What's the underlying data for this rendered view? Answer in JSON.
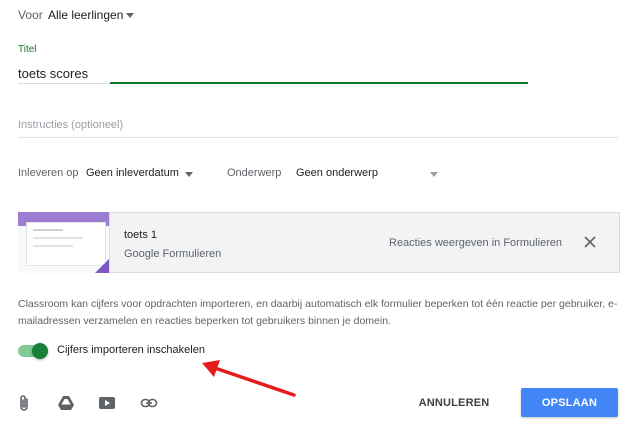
{
  "audience": {
    "label": "Voor",
    "value": "Alle leerlingen"
  },
  "title_field": {
    "label": "Titel",
    "value": "toets scores"
  },
  "instructions_field": {
    "placeholder": "Instructies (optioneel)",
    "value": ""
  },
  "due": {
    "label": "Inleveren op",
    "value": "Geen inleverdatum"
  },
  "topic": {
    "label": "Onderwerp",
    "value": "Geen onderwerp"
  },
  "attachment": {
    "title": "toets 1",
    "type": "Google Formulieren",
    "action": "Reacties weergeven in Formulieren",
    "thumbnail_color": "#9c7dd1"
  },
  "info_text": "Classroom kan cijfers voor opdrachten importeren, en daarbij automatisch elk formulier beperken tot één reactie per gebruiker, e-mailadressen verzamelen en reacties beperken tot gebruikers binnen je domein.",
  "grade_import_toggle": {
    "label": "Cijfers importeren inschakelen",
    "on": true,
    "color": "#188038"
  },
  "toolbar": {
    "icons": [
      "paperclip-icon",
      "google-drive-icon",
      "youtube-icon",
      "link-icon"
    ],
    "cancel_label": "ANNULEREN",
    "save_label": "OPSLAAN"
  },
  "colors": {
    "accent": "#137333",
    "primary_button": "#4285f4",
    "annotation_arrow": "#e51c1c"
  }
}
